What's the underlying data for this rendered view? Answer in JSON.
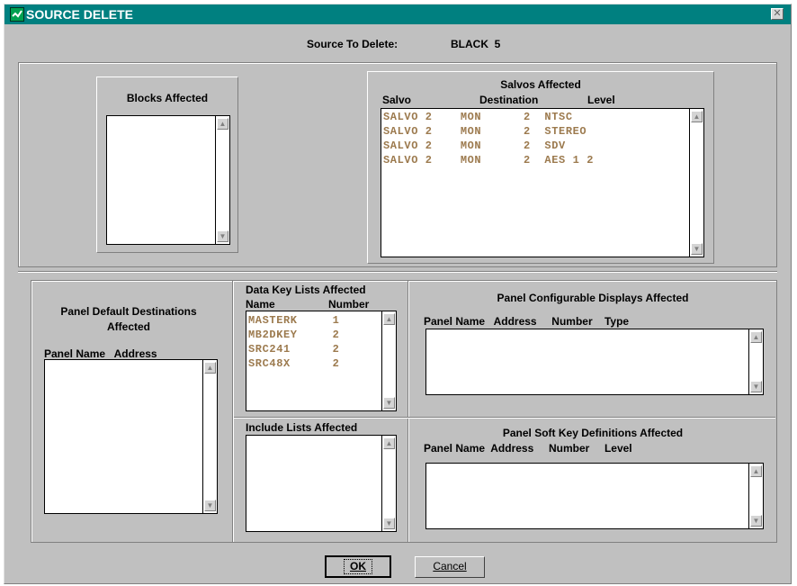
{
  "window": {
    "title": "SOURCE DELETE"
  },
  "source_to_delete": {
    "label": "Source To Delete:",
    "value": "BLACK  5"
  },
  "blocks": {
    "heading": "Blocks Affected"
  },
  "salvos": {
    "heading": "Salvos  Affected",
    "columns": [
      "Salvo",
      "Destination",
      "Level"
    ],
    "rows": [
      "SALVO 2    MON      2  NTSC",
      "SALVO 2    MON      2  STEREO",
      "SALVO 2    MON      2  SDV",
      "SALVO 2    MON      2  AES 1 2"
    ]
  },
  "panel_default": {
    "heading_line1": "Panel Default Destinations",
    "heading_line2": "Affected",
    "columns_label": "Panel Name   Address"
  },
  "data_key_lists": {
    "heading": "Data Key Lists Affected",
    "col_name": "Name",
    "col_number": "Number",
    "rows": [
      "MASTERK     1",
      "MB2DKEY     2",
      "SRC241      2",
      "SRC48X      2"
    ]
  },
  "include_lists": {
    "heading": "Include Lists Affected"
  },
  "panel_config": {
    "heading": "Panel Configurable Displays Affected",
    "columns_label": "Panel Name   Address     Number    Type"
  },
  "panel_soft": {
    "heading": "Panel Soft Key Definitions Affected",
    "columns_label": "Panel Name  Address     Number     Level"
  },
  "buttons": {
    "ok": "OK",
    "cancel": "Cancel"
  }
}
